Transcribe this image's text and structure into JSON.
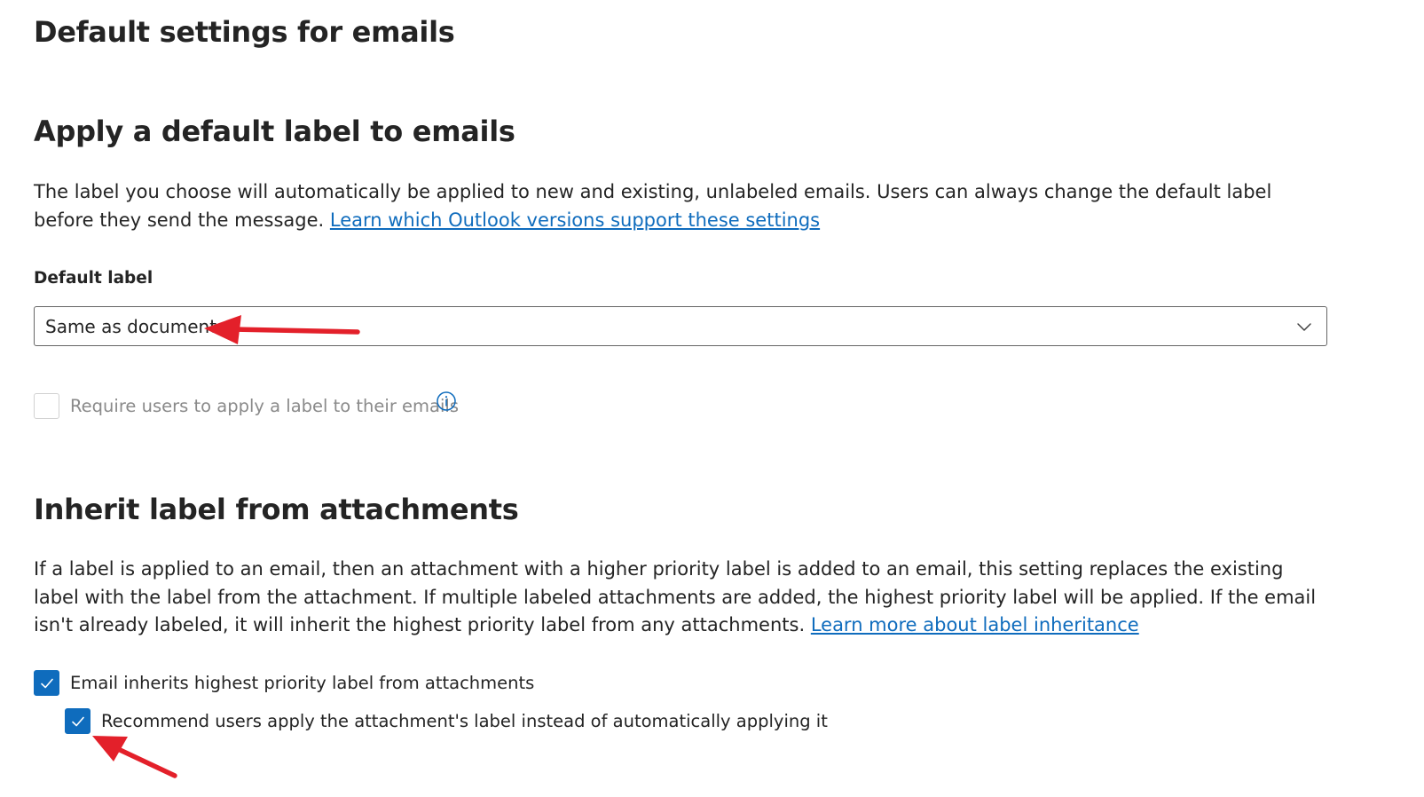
{
  "page": {
    "title": "Default settings for emails"
  },
  "default_label_section": {
    "heading": "Apply a default label to emails",
    "description": "The label you choose will automatically be applied to new and existing, unlabeled emails. Users can always change the default label before they send the message. ",
    "link_text": "Learn which Outlook versions support these settings",
    "field_label": "Default label",
    "dropdown_value": "Same as document",
    "require_checkbox": {
      "label": "Require users to apply a label to their emails",
      "checked": false,
      "disabled": true
    }
  },
  "inherit_section": {
    "heading": "Inherit label from attachments",
    "description": "If a label is applied to an email, then an attachment with a higher priority label is added to an email, this setting replaces the existing label with the label from the attachment. If multiple labeled attachments are added, the highest priority label will be applied. If the email isn't already labeled, it will inherit the highest priority label from any attachments. ",
    "link_text": "Learn more about label inheritance",
    "inherit_checkbox": {
      "label": "Email inherits highest priority label from attachments",
      "checked": true
    },
    "recommend_checkbox": {
      "label": "Recommend users apply the attachment's label instead of automatically applying it",
      "checked": true
    }
  },
  "colors": {
    "accent": "#0f6cbd",
    "annotation_arrow": "#e3202a",
    "text": "#242424",
    "disabled_text": "#8a8a8a"
  },
  "icons": {
    "dropdown": "chevron-down-icon",
    "info": "info-icon",
    "check": "checkmark-icon"
  }
}
